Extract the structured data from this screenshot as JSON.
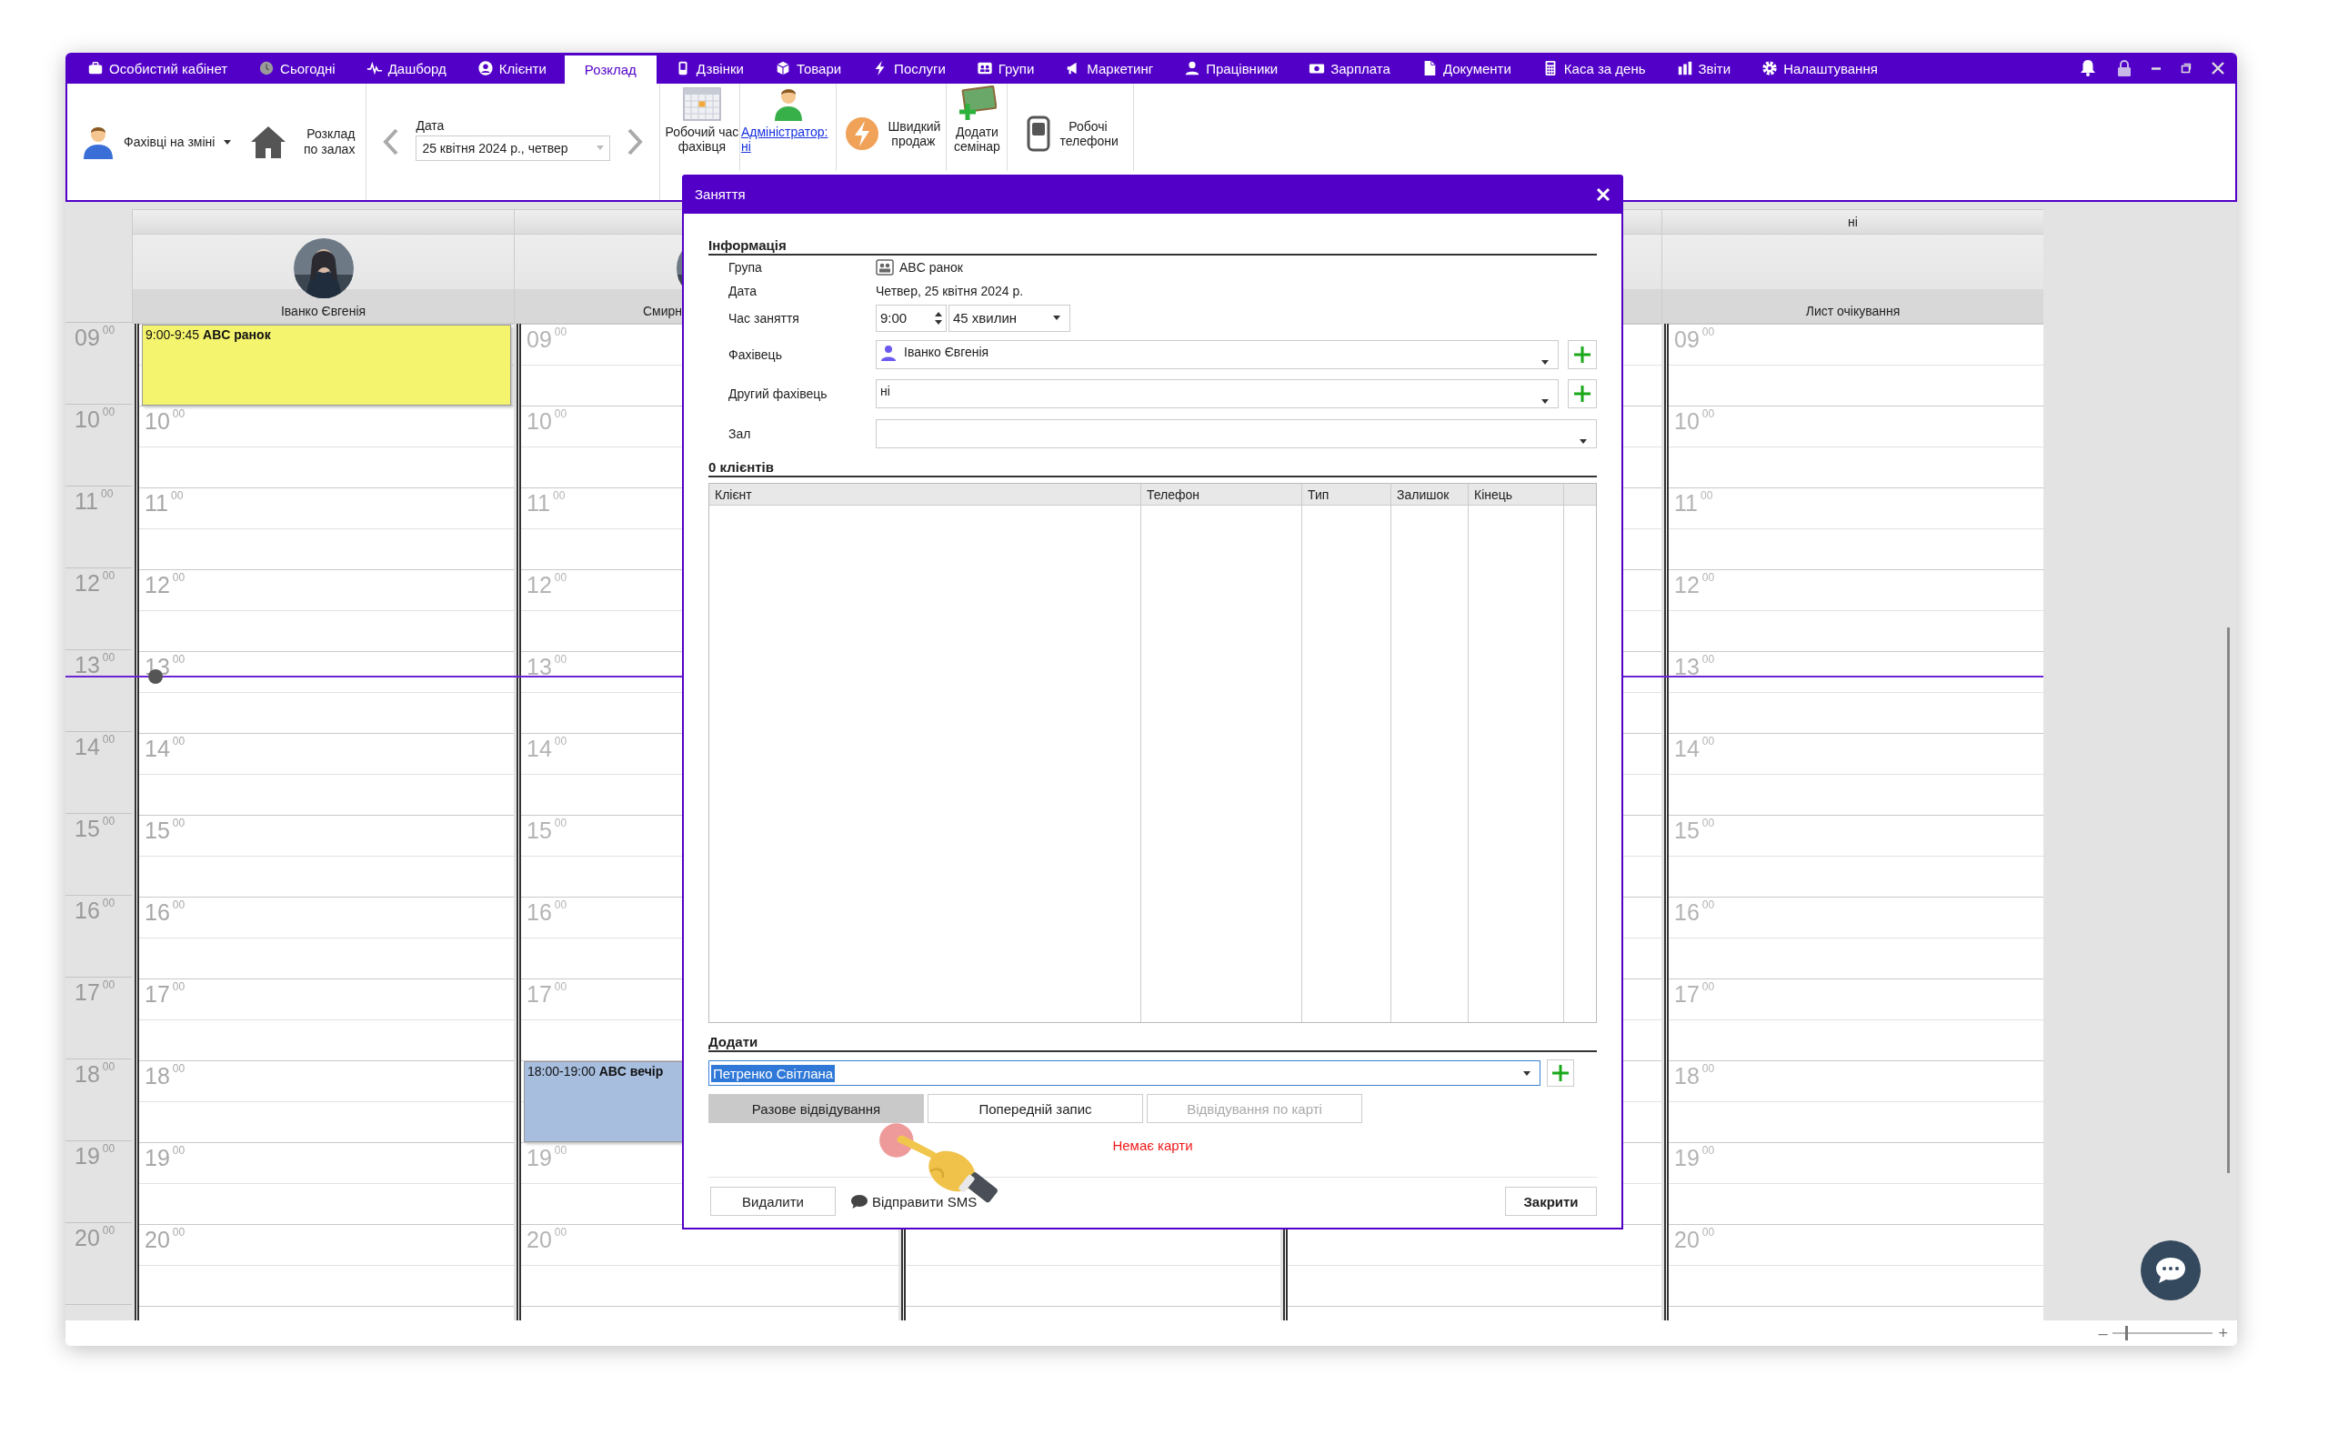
{
  "menu": {
    "items": [
      {
        "label": "Особистий кабінет",
        "selected": false
      },
      {
        "label": "Сьогодні",
        "selected": false
      },
      {
        "label": "Дашборд",
        "selected": false
      },
      {
        "label": "Клієнти",
        "selected": false
      },
      {
        "label": "Розклад",
        "selected": true
      },
      {
        "label": "Дзвінки",
        "selected": false
      },
      {
        "label": "Товари",
        "selected": false
      },
      {
        "label": "Послуги",
        "selected": false
      },
      {
        "label": "Групи",
        "selected": false
      },
      {
        "label": "Маркетинг",
        "selected": false
      },
      {
        "label": "Працівники",
        "selected": false
      },
      {
        "label": "Зарплата",
        "selected": false
      },
      {
        "label": "Документи",
        "selected": false
      },
      {
        "label": "Каса за день",
        "selected": false
      },
      {
        "label": "Звіти",
        "selected": false
      },
      {
        "label": "Налаштування",
        "selected": false
      }
    ]
  },
  "toolbar": {
    "staff_on_shift": "Фахівці на зміні",
    "rooms_schedule": "Розклад по залах",
    "date_label": "Дата",
    "date_value": "25 квітня 2024 р., четвер",
    "buttons": [
      {
        "label": "Робочий час фахівця",
        "kind": "button"
      },
      {
        "label": "Адміністратор: ні",
        "kind": "link"
      },
      {
        "label": "Швидкий продаж",
        "kind": "button"
      },
      {
        "label": "Додати семінар",
        "kind": "button"
      },
      {
        "label": "Робочі телефони",
        "kind": "button"
      }
    ]
  },
  "calendar": {
    "hours": [
      "09$^{00}$",
      "10$^{00}$",
      "11$^{00}$",
      "12$^{00}$",
      "13$^{00}$",
      "14$^{00}$",
      "15$^{00}$",
      "16$^{00}$",
      "17$^{00}$",
      "18$^{00}$",
      "19$^{00}$",
      "20$^{00}$"
    ],
    "columns": [
      {
        "title": "Іванко Євгенія",
        "avatar": true,
        "working": true,
        "slots": [
          {
            "kind": "event",
            "text": "9:00-9:45 **ABC ранок**",
            "color": "#f5f46e"
          },
          {
            "kind": "hour",
            "label": "10$^{00}$"
          },
          {
            "kind": "hour",
            "label": "11$^{00}$"
          },
          {
            "kind": "hour",
            "label": "12$^{00}$"
          },
          {
            "kind": "hour",
            "label": "13$^{00}$"
          },
          {
            "kind": "hour",
            "label": "14$^{00}$"
          },
          {
            "kind": "hour",
            "label": "15$^{00}$"
          },
          {
            "kind": "hour",
            "label": "16$^{00}$"
          },
          {
            "kind": "hour",
            "label": "17$^{00}$"
          },
          {
            "kind": "hour",
            "label": "18$^{00}$"
          },
          {
            "kind": "hour",
            "label": "19$^{00}$"
          },
          {
            "kind": "hour",
            "label": "20$^{00}$"
          }
        ]
      },
      {
        "title": "Смирн",
        "avatar": true,
        "working": false,
        "slots": [
          {
            "kind": "hour",
            "label": "09$^{00}$"
          },
          {
            "kind": "hour",
            "label": "10$^{00}$"
          },
          {
            "kind": "hour",
            "label": "11$^{00}$"
          },
          {
            "kind": "hour",
            "label": "12$^{00}$"
          },
          {
            "kind": "hour",
            "label": "13$^{00}$"
          },
          {
            "kind": "hour",
            "label": "14$^{00}$"
          },
          {
            "kind": "hour",
            "label": "15$^{00}$"
          },
          {
            "kind": "hour",
            "label": "16$^{00}$"
          },
          {
            "kind": "hour",
            "label": "17$^{00}$"
          },
          {
            "kind": "event",
            "text": "18:00-19:00 **ABC вечір**",
            "color": "#a7bedf"
          },
          {
            "kind": "hour",
            "label": "19$^{00}$"
          },
          {
            "kind": "hour",
            "label": "20$^{00}$"
          }
        ]
      },
      {},
      {},
      {
        "top_label": "ні",
        "title": "Лист очікування",
        "avatar": false,
        "working": false,
        "slots": [
          {
            "kind": "hour",
            "label": "09$^{00}$"
          },
          {
            "kind": "hour",
            "label": "10$^{00}$"
          },
          {
            "kind": "hour",
            "label": "11$^{00}$"
          },
          {
            "kind": "hour",
            "label": "12$^{00}$"
          },
          {
            "kind": "hour",
            "label": "13$^{00}$"
          },
          {
            "kind": "hour",
            "label": "14$^{00}$"
          },
          {
            "kind": "hour",
            "label": "15$^{00}$"
          },
          {
            "kind": "hour",
            "label": "16$^{00}$"
          },
          {
            "kind": "hour",
            "label": "17$^{00}$"
          },
          {
            "kind": "hour",
            "label": "18$^{00}$"
          },
          {
            "kind": "hour",
            "label": "19$^{00}$"
          },
          {
            "kind": "hour",
            "label": "20$^{00}$"
          }
        ]
      }
    ]
  },
  "dialog": {
    "title": "Заняття",
    "info_heading": "Інформація",
    "fields": [
      {
        "label": "Група",
        "kind": "group",
        "value": "ABC ранок"
      },
      {
        "label": "Дата",
        "kind": "text",
        "value": "Четвер, 25 квітня 2024 р."
      },
      {
        "label": "Час заняття",
        "kind": "time",
        "value": "9:00",
        "duration": "45 хвилин"
      },
      {
        "label": "Фахівець",
        "kind": "person",
        "value": "Іванко Євгенія"
      },
      {
        "label": "Другий фахівець",
        "kind": "select-add",
        "value": "ні"
      },
      {
        "label": "Зал",
        "kind": "select"
      }
    ],
    "clients_heading": "0 клієнтів",
    "table": {
      "columns": [
        "Клієнт",
        "Телефон",
        "Тип",
        "Залишок",
        "Кінець"
      ]
    },
    "add_heading": "Додати",
    "add_value": "Петренко Світлана",
    "visit_buttons": [
      {
        "label": "Разове відвідування",
        "selected": true,
        "disabled": false
      },
      {
        "label": "Попередній запис",
        "selected": false,
        "disabled": false
      },
      {
        "label": "Відвідування по карті",
        "selected": false,
        "disabled": true
      }
    ],
    "warning": "Немає карти",
    "delete": "Видалити",
    "sms": "Відправити SMS",
    "close_button": "Закрити"
  },
  "zoom": {
    "minus": "–",
    "plus": "+",
    "level": 0.12
  }
}
